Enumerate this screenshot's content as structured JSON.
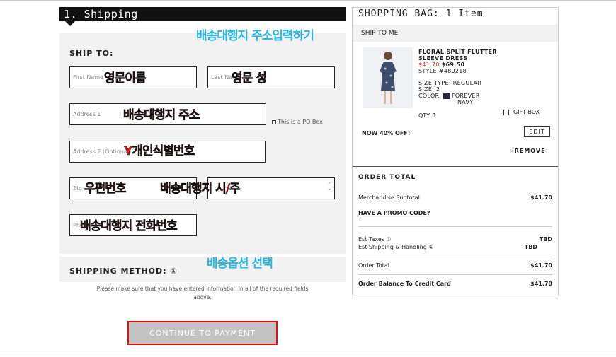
{
  "shipping": {
    "header": "1. Shipping",
    "ship_to_label": "SHIP TO:",
    "first_name_placeholder": "First Name",
    "last_name_placeholder": "Last Name",
    "address1_placeholder": "Address 1",
    "po_box_label": "This is a PO Box",
    "address2_placeholder": "Address 2 (Optional)",
    "zip_placeholder": "Zip",
    "phone_placeholder": "Phone",
    "method_label": "SHIPPING METHOD: ①",
    "notice_line1": "Please make sure that you have entered information in all of the required fields",
    "notice_line2": "above.",
    "continue_button": "CONTINUE TO PAYMENT"
  },
  "bag": {
    "title": "SHOPPING BAG: 1 Item",
    "ship_tab": "SHIP TO ME",
    "product": {
      "name1": "FLORAL SPLIT FLUTTER",
      "name2": "SLEEVE DRESS",
      "sale_price": "$41.70",
      "orig_price": "$69.50",
      "style": "STYLE #480218",
      "size_type": "SIZE TYPE: REGULAR",
      "size": "SIZE: 2",
      "color_label": "COLOR:",
      "color_name1": "FOREVER",
      "color_name2": "NAVY",
      "qty": "QTY: 1",
      "gift_box": "GIFT BOX",
      "promo": "NOW 40% OFF!",
      "edit": "EDIT",
      "remove": "REMOVE",
      "swatch_color": "#222733"
    },
    "order_total_title": "ORDER TOTAL",
    "merch_label": "Merchandise Subtotal",
    "merch_value": "$41.70",
    "promo_link": "HAVE A PROMO CODE?",
    "taxes_label": "Est Taxes ①",
    "taxes_value": "TBD",
    "shipping_label": "Est Shipping & Handling  ①",
    "shipping_value": "TBD",
    "order_total_label": "Order Total",
    "order_total_value": "$41.70",
    "balance_label": "Order Balance To Credit Card",
    "balance_value": "$41.70"
  },
  "annotations": {
    "enter_address": "배송대행지 주소입력하기",
    "english_name": "영문이름",
    "english_surname": "영문 성",
    "forwarder_address": "배송대행지 주소",
    "personal_id": "Y개인식별번호",
    "zip_code": "우편번호",
    "city_state": "배송대행지 시/주",
    "phone": "배송대행지 전화번호",
    "shipping_option": "배송옵션 선택"
  },
  "colors": {
    "header_bg": "#111111",
    "panel_bg": "#f2f2f2",
    "highlight_red": "#e01010",
    "annotation_red": "#e31414",
    "annotation_blue": "#27b6e6",
    "sale_red": "#c0392b"
  }
}
